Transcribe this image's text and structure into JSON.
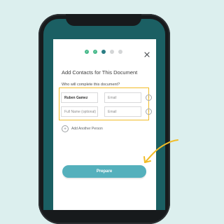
{
  "modal": {
    "title": "Add Contacts for This Document",
    "subtitle": "Who will complete this document?",
    "close_icon": "close-icon",
    "progress": {
      "steps": [
        {
          "state": "done",
          "icon": "checkmark-icon"
        },
        {
          "state": "done",
          "icon": "checkmark-icon"
        },
        {
          "state": "current",
          "icon": "dot-icon"
        },
        {
          "state": "todo",
          "icon": "dot-icon"
        },
        {
          "state": "todo",
          "icon": "dot-icon"
        }
      ]
    },
    "contacts": [
      {
        "name_value": "Ruben Gamez",
        "email_placeholder": "Email",
        "email_value": "",
        "remove_icon": "minus-circle-icon"
      },
      {
        "name_placeholder": "Full Name (optional)",
        "email_placeholder": "Email",
        "name_value": "",
        "email_value": "",
        "remove_icon": "minus-circle-icon"
      }
    ],
    "add_person_label": "Add Another Person",
    "add_person_icon": "plus-circle-icon",
    "prepare_label": "Prepare"
  },
  "colors": {
    "background": "#dcefee",
    "phone_frame": "#171a1c",
    "screen_teal": "#1b5f63",
    "progress_done": "#46b98a",
    "progress_current": "#2a7d84",
    "highlight_border": "#f1bc27",
    "prepare_button": "#54b0bc",
    "arrow": "#f1bc27"
  }
}
